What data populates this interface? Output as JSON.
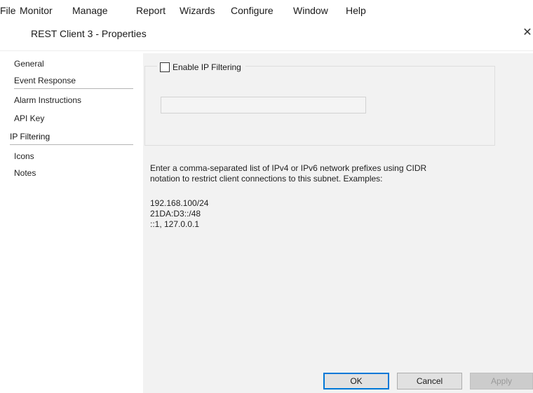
{
  "menu": {
    "items": [
      "File",
      "Monitor",
      "Manage",
      "Report",
      "Wizards",
      "Configure",
      "Window",
      "Help"
    ]
  },
  "dialog": {
    "title": "REST Client 3 - Properties",
    "close_icon": "close-icon"
  },
  "nav": {
    "items": [
      {
        "label": "General"
      },
      {
        "label": "Event Response"
      },
      {
        "label": "Alarm Instructions"
      },
      {
        "label": "API Key"
      },
      {
        "label": "IP Filtering",
        "selected": true
      },
      {
        "label": "Icons"
      },
      {
        "label": "Notes"
      }
    ]
  },
  "ip_filtering": {
    "enable_label": "Enable IP Filtering",
    "enabled": false,
    "input_value": "",
    "help_lines": [
      "Enter a comma-separated list of IPv4 or IPv6 network prefixes using CIDR",
      "notation to restrict client connections to this subnet.  Examples:"
    ],
    "examples": [
      "192.168.100/24",
      "21DA:D3::/48",
      "::1, 127.0.0.1"
    ]
  },
  "buttons": {
    "ok": "OK",
    "cancel": "Cancel",
    "apply": "Apply"
  },
  "colors": {
    "panel_background": "#f2f2f2",
    "ok_border": "#0078d7",
    "disabled_text": "#9a9a9a"
  }
}
